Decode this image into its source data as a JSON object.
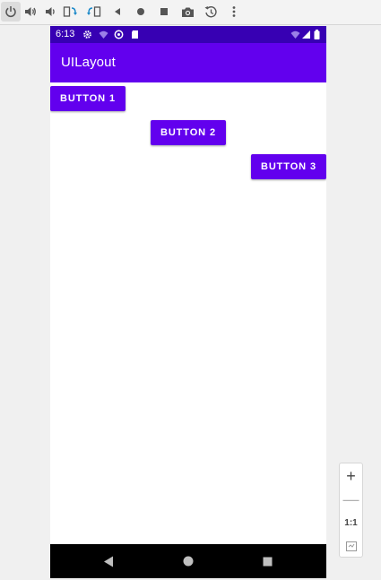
{
  "status_bar": {
    "time": "6:13"
  },
  "app_bar": {
    "title": "UILayout"
  },
  "buttons": [
    {
      "label": "BUTTON 1"
    },
    {
      "label": "BUTTON 2"
    },
    {
      "label": "BUTTON 3"
    }
  ],
  "zoom_panel": {
    "zoom_in": "+",
    "zoom_out": "—",
    "actual_size": "1:1"
  },
  "colors": {
    "status_bar": "#3700b3",
    "primary": "#6200ee",
    "nav_bar": "#000000",
    "content_bg": "#ffffff"
  },
  "toolbar_icons": [
    "power-icon",
    "volume-up-icon",
    "volume-down-icon",
    "rotate-left-icon",
    "rotate-right-icon",
    "back-icon",
    "home-icon",
    "overview-icon",
    "camera-icon",
    "snapshot-icon",
    "more-icon"
  ]
}
